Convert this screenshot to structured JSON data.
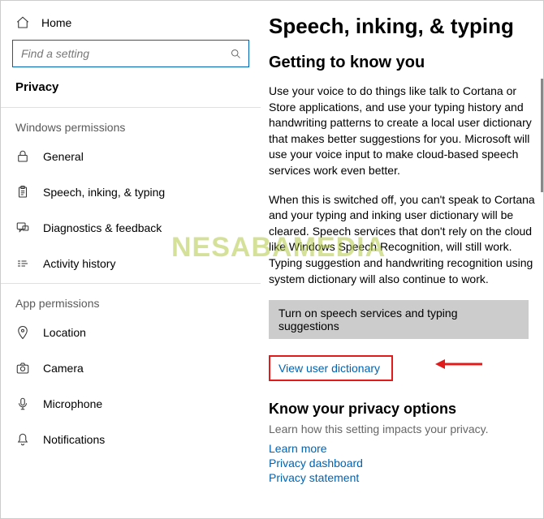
{
  "sidebar": {
    "home": "Home",
    "search_placeholder": "Find a setting",
    "category": "Privacy",
    "section1": "Windows permissions",
    "items1": [
      {
        "label": "General",
        "icon": "lock-icon"
      },
      {
        "label": "Speech, inking, & typing",
        "icon": "clipboard-icon"
      },
      {
        "label": "Diagnostics & feedback",
        "icon": "feedback-icon"
      },
      {
        "label": "Activity history",
        "icon": "history-icon"
      }
    ],
    "section2": "App permissions",
    "items2": [
      {
        "label": "Location",
        "icon": "location-icon"
      },
      {
        "label": "Camera",
        "icon": "camera-icon"
      },
      {
        "label": "Microphone",
        "icon": "mic-icon"
      },
      {
        "label": "Notifications",
        "icon": "bell-icon"
      }
    ]
  },
  "content": {
    "title": "Speech, inking, & typing",
    "subtitle": "Getting to know you",
    "para1": "Use your voice to do things like talk to Cortana or Store applications, and use your typing history and handwriting patterns to create a local user dictionary that makes better suggestions for you. Microsoft will use your voice input to make cloud-based speech services work even better.",
    "para2": "When this is switched off, you can't speak to Cortana and your typing and inking user dictionary will be cleared. Speech services that don't rely on the cloud like Windows Speech Recognition, will still work. Typing suggestion and handwriting recognition using system dictionary will also continue to work.",
    "toggle_btn": "Turn on speech services and typing suggestions",
    "view_dict": "View user dictionary",
    "privacy_heading": "Know your privacy options",
    "privacy_sub": "Learn how this setting impacts your privacy.",
    "links": {
      "learn": "Learn more",
      "dashboard": "Privacy dashboard",
      "statement": "Privacy statement"
    }
  },
  "watermark": "NESABAMEDIA"
}
